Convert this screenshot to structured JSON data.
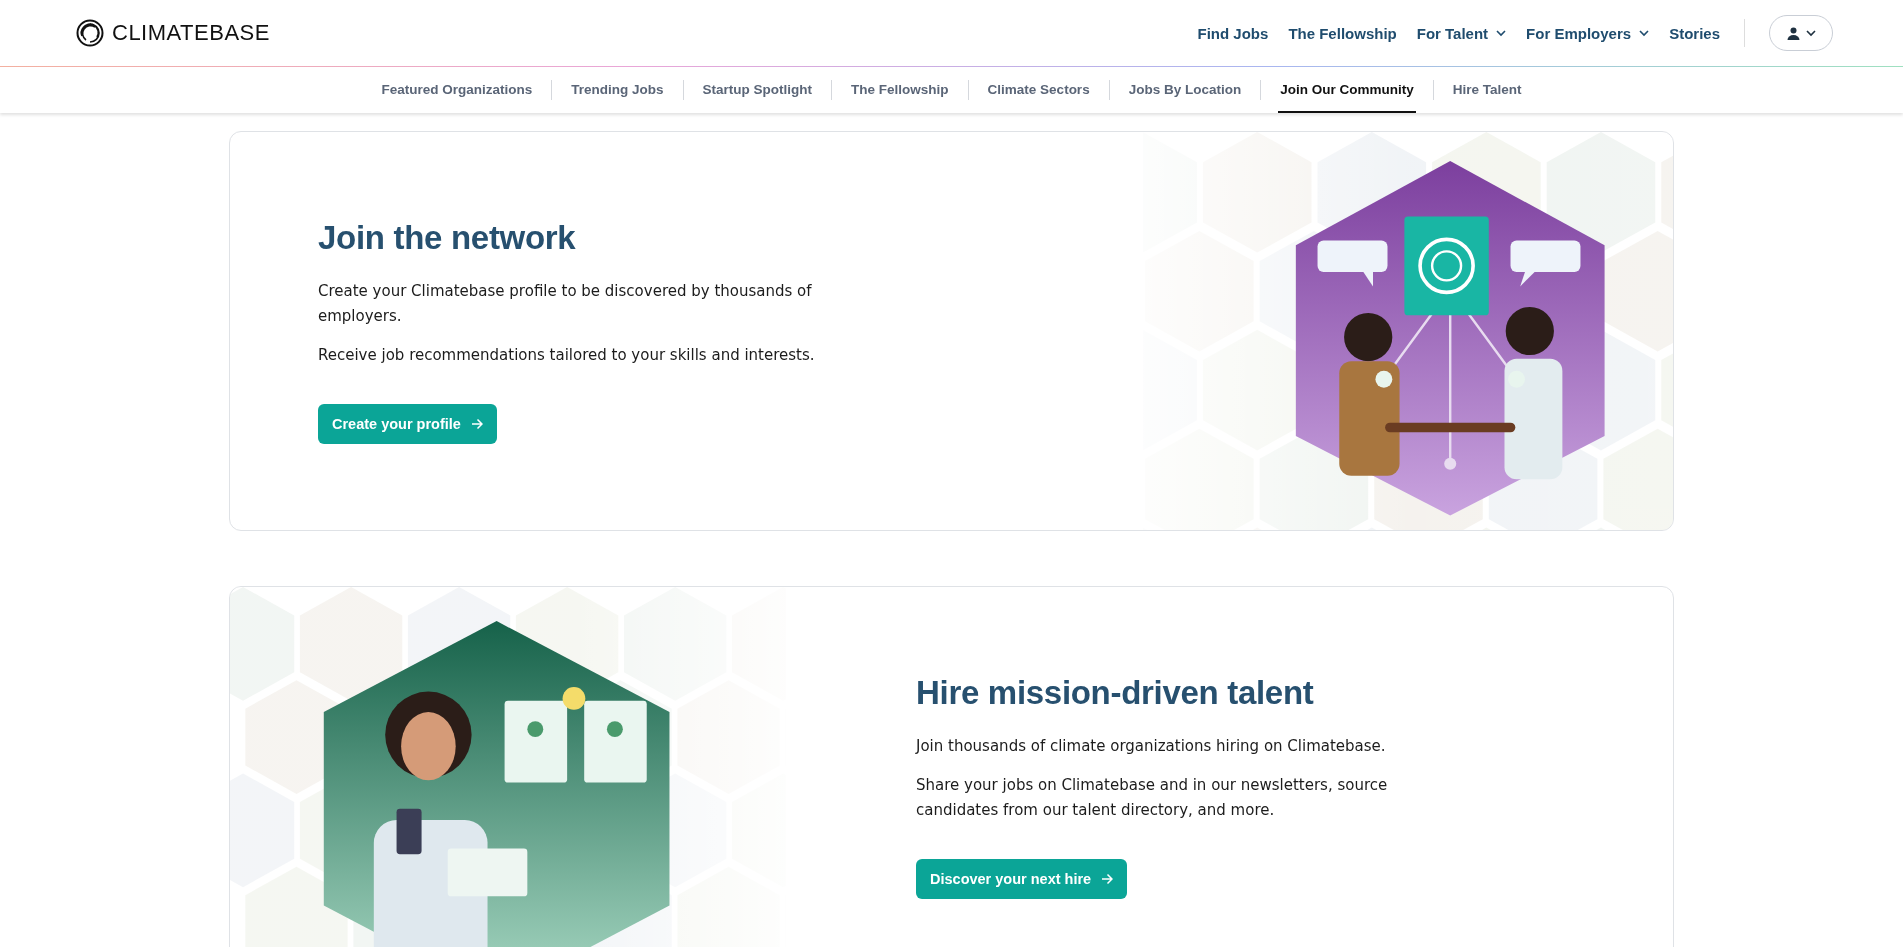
{
  "header": {
    "logo": "CLIMATEBASE",
    "nav": [
      {
        "label": "Find Jobs",
        "kind": "link"
      },
      {
        "label": "The Fellowship",
        "kind": "link"
      },
      {
        "label": "For Talent",
        "kind": "dropdown"
      },
      {
        "label": "For Employers",
        "kind": "dropdown"
      },
      {
        "label": "Stories",
        "kind": "link"
      }
    ]
  },
  "subnav": [
    {
      "label": "Featured Organizations",
      "selected": false
    },
    {
      "label": "Trending Jobs",
      "selected": false
    },
    {
      "label": "Startup Spotlight",
      "selected": false
    },
    {
      "label": "The Fellowship",
      "selected": false
    },
    {
      "label": "Climate Sectors",
      "selected": false
    },
    {
      "label": "Jobs By Location",
      "selected": false
    },
    {
      "label": "Join Our Community",
      "selected": true
    },
    {
      "label": "Hire Talent",
      "selected": false
    }
  ],
  "sections": [
    {
      "kind": "network",
      "image_left": false,
      "title": "Join the network",
      "paragraphs": [
        "Create your Climatebase profile to be discovered by thousands of employers.",
        "Receive job recommendations tailored to your skills and interests."
      ],
      "button": "Create your profile"
    },
    {
      "kind": "hiring",
      "image_left": true,
      "title": "Hire mission-driven talent",
      "paragraphs": [
        "Join thousands of climate organizations hiring on Climatebase.",
        "Share your jobs on Climatebase and in our newsletters, source candidates from our talent directory, and more."
      ],
      "button": "Discover your next hire"
    }
  ]
}
